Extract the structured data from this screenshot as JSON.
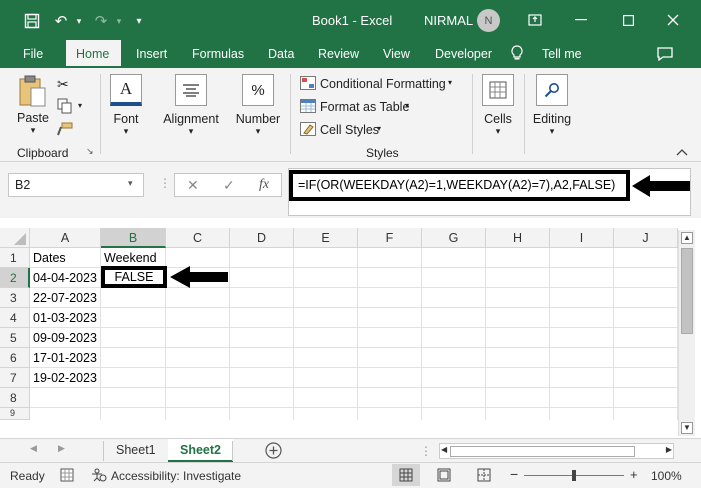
{
  "titlebar": {
    "title": "Book1  -  Excel",
    "user": "NIRMAL",
    "avatar_initial": "N",
    "save_icon": "save-icon",
    "undo_icon": "undo-icon",
    "redo_icon": "redo-icon",
    "customize_icon": "customize-qat-icon"
  },
  "tabs": [
    {
      "label": "File"
    },
    {
      "label": "Home"
    },
    {
      "label": "Insert"
    },
    {
      "label": "Formulas"
    },
    {
      "label": "Data"
    },
    {
      "label": "Review"
    },
    {
      "label": "View"
    },
    {
      "label": "Developer"
    },
    {
      "label": "Tell me"
    }
  ],
  "ribbon": {
    "paste": "Paste",
    "clipboard": "Clipboard",
    "font": "Font",
    "alignment": "Alignment",
    "number": "Number",
    "number_symbol": "%",
    "conditional_formatting": "Conditional Formatting",
    "format_as_table": "Format as Table",
    "cell_styles": "Cell Styles",
    "styles": "Styles",
    "cells": "Cells",
    "editing": "Editing"
  },
  "formula": {
    "name_box": "B2",
    "fx": "fx",
    "cancel": "✕",
    "enter": "✓",
    "content": "=IF(OR(WEEKDAY(A2)=1,WEEKDAY(A2)=7),A2,FALSE)"
  },
  "grid": {
    "columns": [
      "A",
      "B",
      "C",
      "D",
      "E",
      "F",
      "G",
      "H",
      "I",
      "J"
    ],
    "rows": [
      "1",
      "2",
      "3",
      "4",
      "5",
      "6",
      "7",
      "8",
      "9"
    ],
    "cells": {
      "A1": "Dates",
      "B1": "Weekend",
      "A2": "04-04-2023",
      "B2": "FALSE",
      "A3": "22-07-2023",
      "A4": "01-03-2023",
      "A5": "09-09-2023",
      "A6": "17-01-2023",
      "A7": "19-02-2023"
    }
  },
  "sheets": [
    {
      "label": "Sheet1"
    },
    {
      "label": "Sheet2"
    }
  ],
  "status": {
    "ready": "Ready",
    "accessibility": "Accessibility: Investigate",
    "zoom": "100%",
    "zoom_minus": "−",
    "zoom_plus": "+"
  },
  "colors": {
    "brand": "#217346",
    "annotation": "#000000"
  }
}
